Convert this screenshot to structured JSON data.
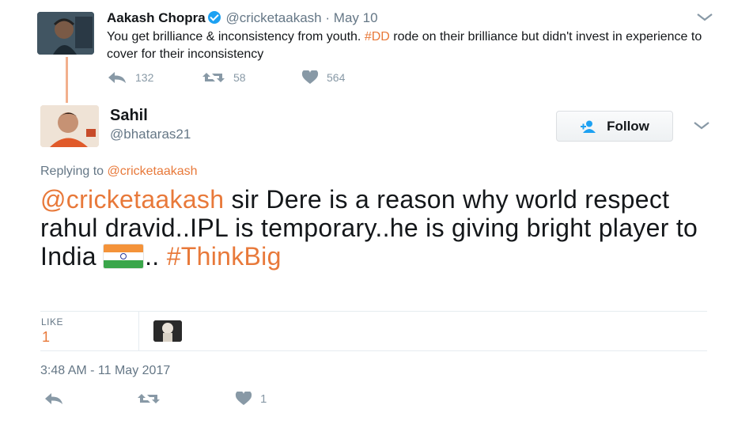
{
  "parent_tweet": {
    "author_name": "Aakash Chopra",
    "handle": "@cricketaakash",
    "separator": "·",
    "date": "May 10",
    "text_before": "You get brilliance & inconsistency from youth. ",
    "hashtag": "#DD",
    "text_after": " rode on their brilliance but didn't invest in experience to cover for their inconsistency",
    "reply_count": "132",
    "retweet_count": "58",
    "like_count": "564",
    "icons": {
      "verified": "verified-badge-icon",
      "menu": "chevron-down-icon",
      "reply": "reply-icon",
      "retweet": "retweet-icon",
      "like": "heart-icon"
    }
  },
  "reply_tweet": {
    "author_name": "Sahil",
    "handle": "@bhataras21",
    "follow_label": "Follow",
    "replying_prefix": "Replying to",
    "replying_to": "@cricketaakash",
    "mention": "@cricketaakash",
    "text": " sir Dere is a reason why world respect rahul dravid..IPL is temporary..he is giving bright player to India ",
    "flag_emoji": "india-flag-icon",
    "ellipsis": "..",
    "hashtag": "#ThinkBig",
    "like_label": "LIKE",
    "like_count_stat": "1",
    "timestamp": "3:48 AM - 11 May 2017",
    "action_like_count": "1",
    "icons": {
      "follow": "add-user-icon",
      "menu": "chevron-down-icon",
      "reply": "reply-icon",
      "retweet": "retweet-icon",
      "like": "heart-icon"
    }
  },
  "colors": {
    "accent": "#e8793a",
    "muted": "#657786",
    "action_gray": "#8899a6",
    "verified_blue": "#1da1f2",
    "divider": "#e6ecf0"
  }
}
